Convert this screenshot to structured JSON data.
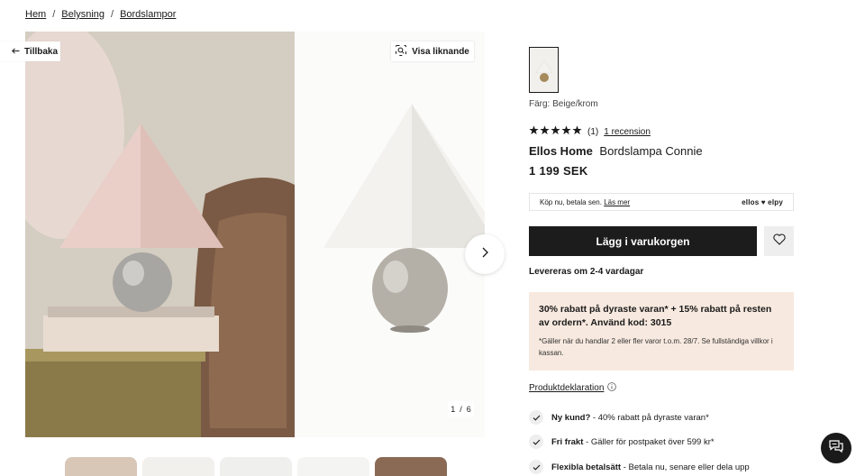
{
  "breadcrumb": {
    "items": [
      "Hem",
      "Belysning",
      "Bordslampor"
    ],
    "separator": "/"
  },
  "gallery": {
    "back_label": "Tillbaka",
    "similar_label": "Visa liknande",
    "counter_current": "1",
    "counter_sep": "/",
    "counter_total": "6",
    "thumb_colors": [
      "#d8c7b7",
      "#f2f0ec",
      "#efefed",
      "#f4f4f2",
      "#8b6a55"
    ]
  },
  "product": {
    "color_label": "Färg: Beige/krom",
    "rating_count": "(1)",
    "review_link": "1 recension",
    "stars": 5,
    "brand": "Ellos Home",
    "name": "Bordslampa Connie",
    "price": "1 199 SEK"
  },
  "payment": {
    "text": "Köp nu, betala sen.",
    "link": "Läs mer",
    "logos": "ellos ♥ elpy"
  },
  "actions": {
    "cart_label": "Lägg i varukorgen"
  },
  "delivery": "Levereras om 2-4 vardagar",
  "promo": {
    "title": "30% rabatt på dyraste varan* + 15% rabatt på resten av ordern*. Använd kod: 3015",
    "note": "*Gäller när du handlar 2 eller fler varor t.o.m. 28/7. Se fullständiga villkor i kassan."
  },
  "declaration_label": "Produktdeklaration",
  "usps": [
    {
      "bold": "Ny kund?",
      "text": " - 40% rabatt på dyraste varan*"
    },
    {
      "bold": "Fri frakt",
      "text": " - Gäller för postpaket över 599 kr*"
    },
    {
      "bold": "Flexibla betalsätt",
      "text": " - Betala nu, senare eller dela upp"
    }
  ],
  "colors": {
    "button_dark": "#1c1c1c",
    "promo_bg": "#f7e9df",
    "chip_bg": "#eeeeee"
  }
}
